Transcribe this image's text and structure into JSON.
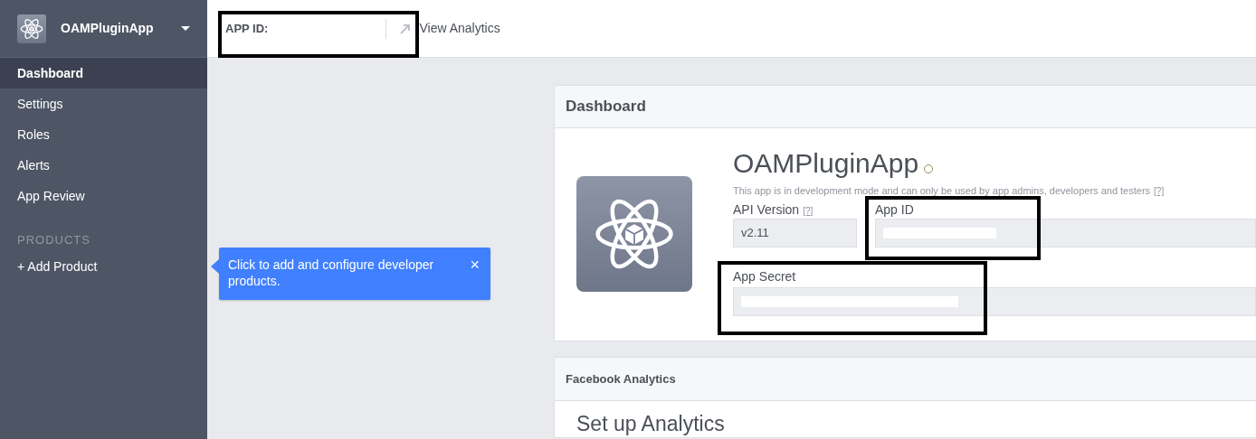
{
  "sidebar": {
    "app_name": "OAMPluginApp",
    "items": [
      {
        "label": "Dashboard",
        "selected": true
      },
      {
        "label": "Settings",
        "selected": false
      },
      {
        "label": "Roles",
        "selected": false
      },
      {
        "label": "Alerts",
        "selected": false
      },
      {
        "label": "App Review",
        "selected": false
      }
    ],
    "section_heading": "PRODUCTS",
    "add_product": "+ Add Product"
  },
  "topbar": {
    "app_id_label": "APP ID:",
    "view_analytics": "View Analytics"
  },
  "tooltip": {
    "text": "Click to add and configure developer products.",
    "close": "×"
  },
  "dashboard": {
    "title": "Dashboard",
    "app_name": "OAMPluginApp",
    "notice": "This app is in development mode and can only be used by app admins, developers and testers",
    "notice_help": "[?]",
    "api_version_label": "API Version",
    "api_version_help": "[?]",
    "api_version": "v2.11",
    "app_id_label": "App ID",
    "app_secret_label": "App Secret"
  },
  "analytics": {
    "title": "Facebook Analytics",
    "heading": "Set up Analytics"
  }
}
